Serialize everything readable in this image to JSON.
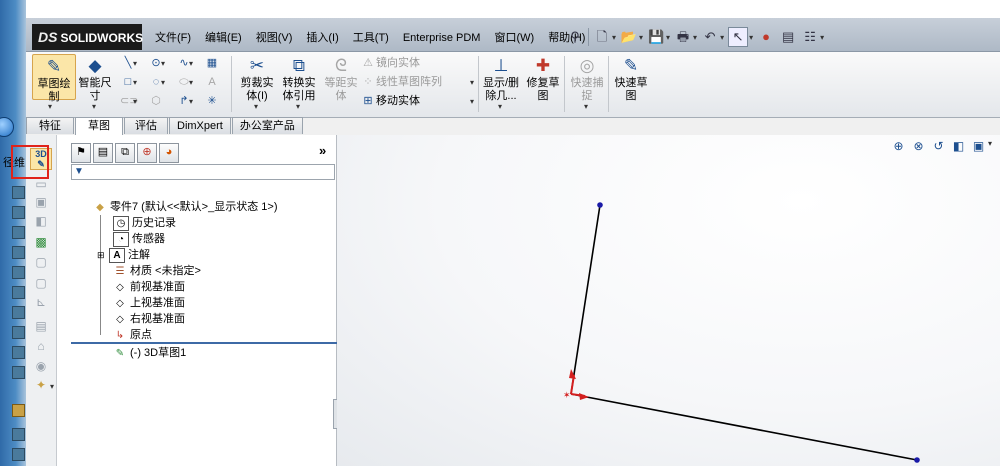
{
  "left_strip": {
    "text": "径维"
  },
  "app": {
    "logo": "SOLIDWORKS",
    "logo_prefix": "DS"
  },
  "menu": [
    "文件(F)",
    "编辑(E)",
    "视图(V)",
    "插入(I)",
    "工具(T)",
    "Enterprise PDM",
    "窗口(W)",
    "帮助(H)"
  ],
  "command_manager": {
    "sketch_draw": "草图绘\n制",
    "smart_dim": "智能尺\n寸",
    "trim": "剪裁实\n体(I)",
    "convert": "转换实\n体引用",
    "offset": "等距实\n体",
    "mirror": "镜向实体",
    "linear_pattern": "线性草图阵列",
    "move": "移动实体",
    "show_delete": "显示/删\n除几...",
    "repair": "修复草\n图",
    "quick_snaps": "快速捕\n捉",
    "rapid_sketch": "快速草\n图"
  },
  "tabs": [
    {
      "label": "特征",
      "active": false
    },
    {
      "label": "草图",
      "active": true
    },
    {
      "label": "评估",
      "active": false
    },
    {
      "label": "DimXpert",
      "active": false
    },
    {
      "label": "办公室产品",
      "active": false
    }
  ],
  "left_toolbar": {
    "sketch3d_label": "3D"
  },
  "feature_tree": {
    "root": "零件7  (默认<<默认>_显示状态 1>)",
    "items": [
      "历史记录",
      "传感器",
      "注解",
      "材质 <未指定>",
      "前视基准面",
      "上视基准面",
      "右视基准面",
      "原点"
    ],
    "sketch": "(-) 3D草图1",
    "expand_label": "»"
  },
  "sketch": {
    "line_color": "#000000",
    "endpoint_color": "#1a1aa8",
    "axis_color": "#d31f1f"
  },
  "colors": {
    "highlight": "#e0241b",
    "accent": "#1d4f8f"
  }
}
